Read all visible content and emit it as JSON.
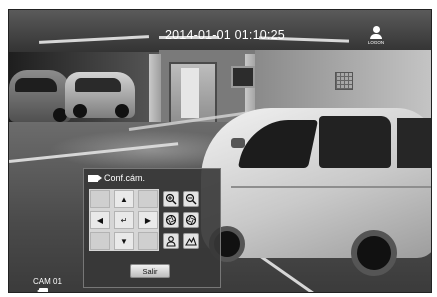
{
  "osd": {
    "timestamp": "2014-01-01 01:10:25",
    "logon_label": "LOGON",
    "camera_name": "CAM 01"
  },
  "ptz_dialog": {
    "title": "Conf.cám.",
    "exit_label": "Salir",
    "pad": {
      "up": "▲",
      "down": "▼",
      "left": "◀",
      "right": "▶",
      "center": "↵"
    },
    "tools": [
      "zoom-in",
      "zoom-out",
      "focus-near",
      "focus-far",
      "iris-open",
      "iris-close"
    ]
  }
}
